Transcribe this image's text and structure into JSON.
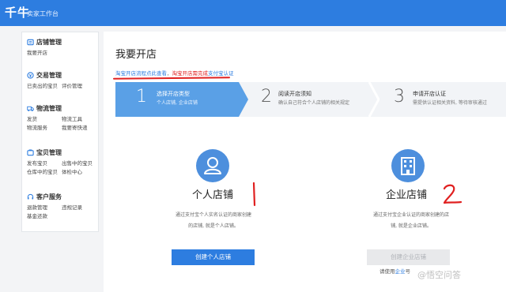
{
  "app": {
    "logo": "千牛",
    "subtitle": "卖家工作台"
  },
  "sidebar": {
    "groups": [
      {
        "title": "店铺管理",
        "links": [
          "我要开店"
        ]
      },
      {
        "title": "交易管理",
        "links": [
          "已卖出的宝贝",
          "评价管理"
        ]
      },
      {
        "title": "物流管理",
        "links": [
          "发货",
          "物流工具",
          "物流服务",
          "我要寄快递"
        ]
      },
      {
        "title": "宝贝管理",
        "links": [
          "发布宝贝",
          "出售中的宝贝",
          "仓库中的宝贝",
          "体检中心"
        ]
      },
      {
        "title": "客户服务",
        "links": [
          "退款管理",
          "违规记录",
          "基金还款"
        ]
      }
    ]
  },
  "main": {
    "title": "我要开店",
    "notice": {
      "link1": "淘宝开店流程点此查看",
      "sep": "，",
      "alert_prefix": "淘宝开店需完成",
      "link2": "支付宝认证"
    },
    "steps": [
      {
        "num": "1",
        "title": "选择开店类型",
        "desc": "个人店铺, 企业店铺"
      },
      {
        "num": "2",
        "title": "阅读开店须知",
        "desc": "确认自己符合个人店铺的相关规定"
      },
      {
        "num": "3",
        "title": "申请开店认证",
        "desc": "需提供认证相关资料, 等待审核通过"
      }
    ],
    "personal": {
      "title": "个人店铺",
      "desc_line1": "通过支付宝个人实名认证的商家创建",
      "desc_line2": "的店铺, 就是个人店铺。",
      "button": "创建个人店铺",
      "annotation": "1"
    },
    "enterprise": {
      "title": "企业店铺",
      "desc_line1": "通过支付宝企业认证的商家创建的店",
      "desc_line2": "铺, 就是企业店铺。",
      "button": "创建企业店铺",
      "hint_prefix": "请使用",
      "hint_link": "企业",
      "hint_suffix": "号",
      "annotation": "2"
    }
  },
  "watermark": "@悟空问答",
  "colors": {
    "brand": "#2d7de0",
    "step_active": "#5aa0e6",
    "alert": "#e02020"
  }
}
